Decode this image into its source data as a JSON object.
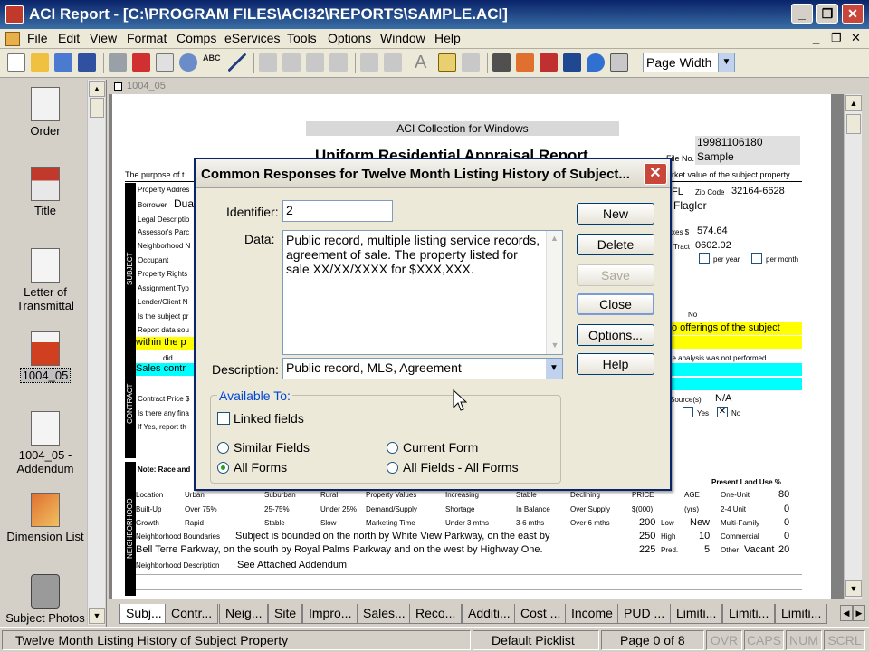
{
  "window": {
    "title": "ACI Report - [C:\\PROGRAM FILES\\ACI32\\REPORTS\\SAMPLE.ACI]",
    "minimize": "_",
    "restore": "❐",
    "close": "✕"
  },
  "menu": [
    "File",
    "Edit",
    "View",
    "Format",
    "Comps",
    "eServices",
    "Tools",
    "Options",
    "Window",
    "Help"
  ],
  "toolbar": {
    "zoom_value": "Page Width"
  },
  "sidebar": {
    "items": [
      {
        "label": "Order",
        "icon": "order-clipboard-icon"
      },
      {
        "label": "Title",
        "icon": "title-house-icon"
      },
      {
        "label": "Letter of Transmittal",
        "icon": "letter-pen-icon"
      },
      {
        "label": "1004_05",
        "icon": "form-1004-icon"
      },
      {
        "label": "1004_05 - Addendum",
        "icon": "addendum-paperclip-icon"
      },
      {
        "label": "Dimension List",
        "icon": "dimension-grid-icon"
      },
      {
        "label": "Subject Photos",
        "icon": "camera-icon"
      }
    ]
  },
  "document": {
    "tab_label": "1004_05",
    "header_box": "ACI Collection for Windows",
    "form_title": "Uniform Residential Appraisal Report",
    "file_no_label": "File No.",
    "file_no": "19981106180",
    "file_name": "Sample",
    "purpose_text": "The purpose of t",
    "right_purpose": "rket value of the subject property.",
    "fields": {
      "fl": "FL",
      "zip_label": "Zip Code",
      "zip": "32164-6628",
      "county": "Flagler",
      "borrower_label": "Borrower",
      "borrower": "Dua",
      "taxes_label": "xes $",
      "taxes": "574.64",
      "tract_label": "Tract",
      "tract": "0602.02",
      "per_year": "per year",
      "per_month": "per month",
      "no_label": "No",
      "offerings": "o offerings of the subject",
      "within": "within the p",
      "sales_contr": "Sales contr",
      "not_performed": "he analysis was not performed.",
      "source_label": "Source(s)",
      "source": "N/A",
      "yes": "Yes",
      "no2": "No",
      "did": "did"
    },
    "row_labels": [
      "Property Addres",
      "Borrower",
      "Legal Descriptio",
      "Assessor's Parc",
      "Neighborhood N",
      "Occupant",
      "Property Rights",
      "Assignment Typ",
      "Lender/Client N",
      "Is the subject pr",
      "Report data sou"
    ],
    "contract_labels": [
      "Contract Price $",
      "Is there any fina",
      "If Yes, report th"
    ],
    "note_text": "Note: Race and",
    "present_land_use": "Present Land Use %",
    "neighborhood": {
      "rows": [
        {
          "label": "Location",
          "opts": [
            "Urban",
            "Suburban",
            "Rural"
          ],
          "checked": "Rural",
          "label2": "Property Values",
          "opts2": [
            "Increasing",
            "Stable",
            "Declining"
          ],
          "checked2": "Stable",
          "price_label": "PRICE",
          "age_label": "AGE",
          "use": "One-Unit",
          "pct": "80"
        },
        {
          "label": "Built-Up",
          "opts": [
            "Over 75%",
            "25-75%",
            "Under 25%"
          ],
          "checked": "Over 75%",
          "label2": "Demand/Supply",
          "opts2": [
            "Shortage",
            "In Balance",
            "Over Supply"
          ],
          "checked2": "In Balance",
          "price_label": "$(000)",
          "age_label": "(yrs)",
          "use": "2-4 Unit",
          "pct": "0"
        },
        {
          "label": "Growth",
          "opts": [
            "Rapid",
            "Stable",
            "Slow"
          ],
          "checked": "Stable",
          "label2": "Marketing Time",
          "opts2": [
            "Under 3 mths",
            "3-6 mths",
            "Over 6 mths"
          ],
          "checked2": "3-6 mths",
          "price": "200",
          "price_tag": "Low",
          "age": "New",
          "use": "Multi-Family",
          "pct": "0"
        }
      ],
      "boundaries_label": "Neighborhood Boundaries",
      "boundaries_1": "Subject is bounded on the north by White View Parkway, on the east by",
      "boundaries_2": "Bell Terre Parkway, on the south by Royal Palms Parkway and on the west by Highway One.",
      "high_price": "250",
      "high_tag": "High",
      "high_age": "10",
      "commercial": "Commercial",
      "commercial_pct": "0",
      "pred_price": "225",
      "pred_tag": "Pred.",
      "pred_age": "5",
      "other": "Other",
      "other_val": "Vacant",
      "other_pct": "20",
      "description_label": "Neighborhood Description",
      "description": "See Attached Addendum"
    },
    "side_labels": [
      "SUBJECT",
      "CONTRACT",
      "NEIGHBORHOOD"
    ]
  },
  "dialog": {
    "title": "Common Responses for Twelve Month Listing History of Subject...",
    "identifier_label": "Identifier:",
    "identifier_value": "2",
    "data_label": "Data:",
    "data_value": "Public record, multiple listing service records, agreement of sale. The property listed for sale XX/XX/XXXX for $XXX,XXX.",
    "description_label": "Description:",
    "description_value": "Public record, MLS, Agreement",
    "available_to": "Available To:",
    "linked_fields": "Linked fields",
    "radio": {
      "similar_fields": "Similar Fields",
      "current_form": "Current Form",
      "all_forms": "All Forms",
      "all_fields_all_forms": "All Fields - All Forms",
      "selected": "All Forms"
    },
    "buttons": {
      "new": "New",
      "delete": "Delete",
      "save": "Save",
      "close": "Close",
      "options": "Options...",
      "help": "Help"
    }
  },
  "bottom_tabs": [
    "Subj...",
    "Contr...",
    "Neig...",
    "Site",
    "Impro...",
    "Sales...",
    "Reco...",
    "Additi...",
    "Cost ...",
    "Income",
    "PUD ...",
    "Limiti...",
    "Limiti...",
    "Limiti..."
  ],
  "status": {
    "field_name": "Twelve Month Listing History of Subject Property",
    "picklist": "Default Picklist",
    "page": "Page 0 of 8",
    "ovr": "OVR",
    "caps": "CAPS",
    "num": "NUM",
    "scrl": "SCRL"
  },
  "colors": {
    "titlebar": "#0a246a",
    "highlight_yellow": "#ffff00",
    "highlight_cyan": "#00ffff",
    "close_red": "#c8463a"
  }
}
